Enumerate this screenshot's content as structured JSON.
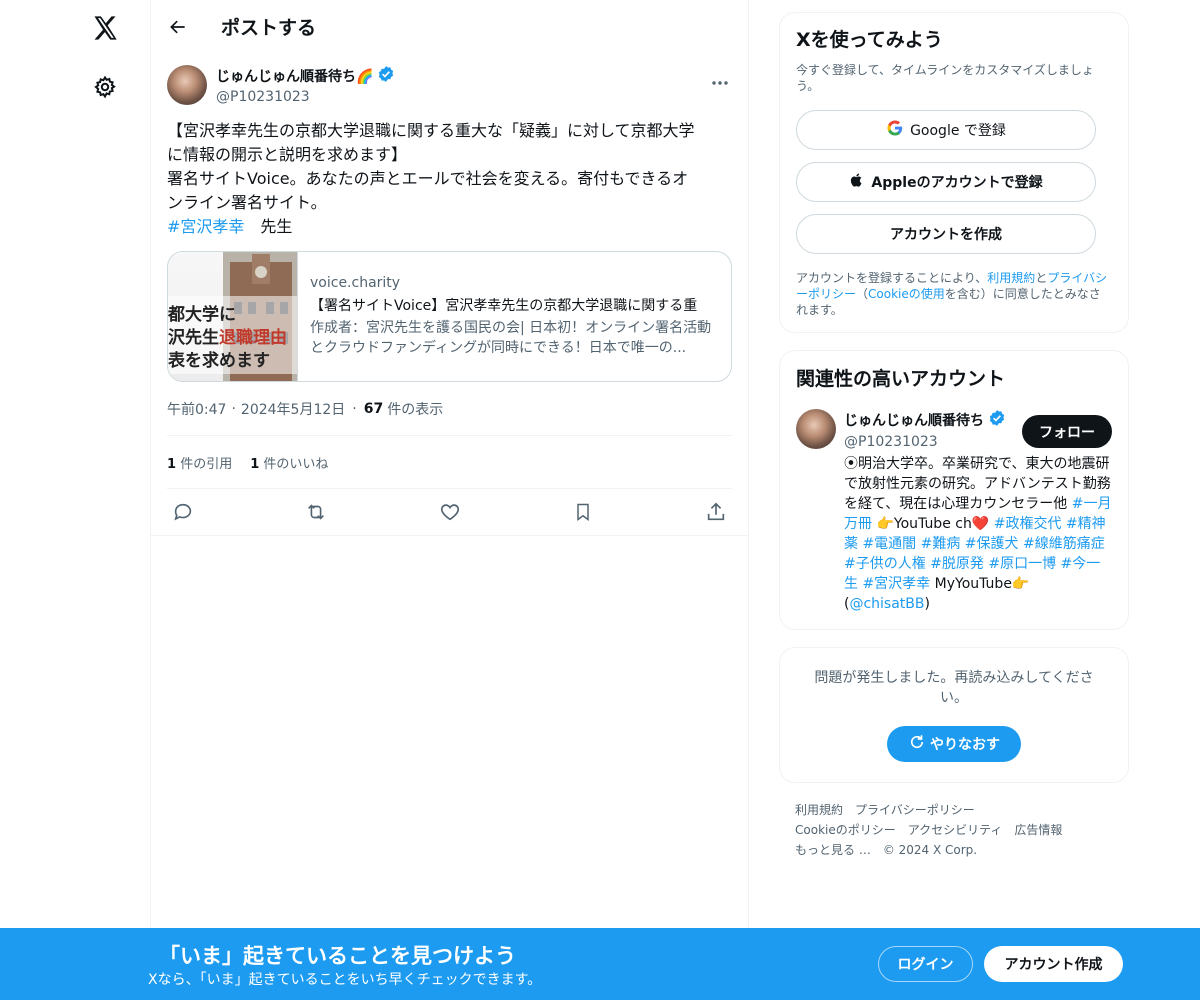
{
  "header": {
    "title": "ポストする"
  },
  "post": {
    "author_name": "じゅんじゅん順番待ち🌈",
    "handle": "@P10231023",
    "text_lines": [
      "【宮沢孝幸先生の京都大学退職に関する重大な「疑義」に対して京都大学",
      "に情報の開示と説明を求めます】",
      "署名サイトVoice。あなたの声とエールで社会を変える。寄付もできるオ",
      "ンライン署名サイト。"
    ],
    "hashtag": "#宮沢孝幸",
    "hashtag_suffix": "　先生",
    "card": {
      "domain": "voice.charity",
      "title": "【署名サイトVoice】宮沢孝幸先生の京都大学退職に関する重",
      "description": "作成者：宮沢先生を護る国民の会| 日本初！オンライン署名活動とクラウドファンディングが同時にできる！日本で唯一の...",
      "thumb_lines": [
        "都大学に",
        "沢先生",
        "退職理由",
        "表を求めます"
      ]
    },
    "time": "午前0:47",
    "date": "2024年5月12日",
    "views_count": "67",
    "views_label": "件の表示",
    "quotes_count": "1",
    "quotes_label": "件の引用",
    "likes_count": "1",
    "likes_label": "件のいいね"
  },
  "signup_box": {
    "title": "Xを使ってみよう",
    "subtitle": "今すぐ登録して、タイムラインをカスタマイズしましょう。",
    "google_label": "Google で登録",
    "apple_label": "Appleのアカウントで登録",
    "create_label": "アカウントを作成",
    "legal_prefix": "アカウントを登録することにより、",
    "terms_link": "利用規約",
    "legal_and": "と",
    "privacy_link": "プライバシーポリシー",
    "legal_mid": "（",
    "cookie_link": "Cookieの使用",
    "legal_suffix": "を含む）に同意したとみなされます。"
  },
  "related": {
    "title": "関連性の高いアカウント",
    "name": "じゅんじゅん順番待ち",
    "handle": "@P10231023",
    "follow_label": "フォロー",
    "bio_text": "⦿明治大学卒。卒業研究で、東大の地震研で放射性元素の研究。アドバンテスト勤務を経て、現在は心理カウンセラー他 ",
    "bio_tags_1": "#一月万冊",
    "bio_text_2": " 👉YouTube ch❤️ ",
    "bio_tags_2": "#政権交代 #精神薬 #電通闇 #難病 #保護犬 #線維筋痛症 #子供の人権 #脱原発 #原口一博 #今一生 #宮沢孝幸",
    "bio_text_3": " MyYouTube👉(",
    "bio_link": "@chisatBB",
    "bio_text_4": ")"
  },
  "error_box": {
    "message": "問題が発生しました。再読み込みしてください。",
    "retry_label": "やりなおす"
  },
  "footer": {
    "links": [
      "利用規約",
      "プライバシーポリシー",
      "Cookieのポリシー",
      "アクセシビリティ",
      "広告情報",
      "もっと見る …"
    ],
    "copyright": "© 2024 X Corp."
  },
  "bottom_bar": {
    "title": "「いま」起きていることを見つけよう",
    "subtitle": "Xなら、「いま」起きていることをいち早くチェックできます。",
    "login_label": "ログイン",
    "signup_label": "アカウント作成"
  }
}
